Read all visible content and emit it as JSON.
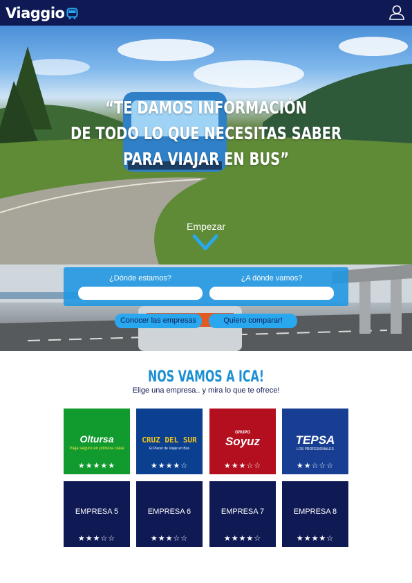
{
  "header": {
    "logo": "Viaggio",
    "icons": [
      "bus-icon",
      "user-icon"
    ]
  },
  "hero": {
    "quote_lines": [
      "“Te damos información",
      "de todo lo que necesitas saber",
      "para viajar en bus”"
    ],
    "start_label": "Empezar",
    "icons": [
      "chevron-down-icon"
    ]
  },
  "search": {
    "origin_label": "¿Dónde estamos?",
    "destination_label": "¿A dónde vamos?",
    "origin_value": "",
    "destination_value": "",
    "companies_button": "Conocer las empresas",
    "compare_button": "Quiero comparar!"
  },
  "section": {
    "title": "Nos vamos a ICA!",
    "subtitle": "Elige una empresa.. y mira lo que te ofrece!"
  },
  "companies": [
    {
      "name": "Oltursa",
      "tagline": "Viaja seguro en primera clase",
      "rating": 5,
      "stars": "★★★★★",
      "bg": "#119a2e"
    },
    {
      "name": "CRUZ DEL SUR",
      "tagline": "El Placer de Viajar en Bus",
      "rating": 4,
      "stars": "★★★★☆",
      "bg": "#0b3f8f"
    },
    {
      "name": "Soyuz",
      "tagline": "GRUPO",
      "rating": 3,
      "stars": "★★★☆☆",
      "bg": "#b30f1f"
    },
    {
      "name": "TEPSA",
      "tagline": "LOS PROFESIONALES",
      "rating": 2,
      "stars": "★★☆☆☆",
      "bg": "#183e93"
    },
    {
      "name": "EMPRESA 5",
      "rating": 3,
      "stars": "★★★☆☆",
      "bg": "#0f1a54"
    },
    {
      "name": "EMPRESA 6",
      "rating": 3,
      "stars": "★★★☆☆",
      "bg": "#0f1a54"
    },
    {
      "name": "EMPRESA 7",
      "rating": 4,
      "stars": "★★★★☆",
      "bg": "#0f1a54"
    },
    {
      "name": "EMPRESA 8",
      "rating": 4,
      "stars": "★★★★☆",
      "bg": "#0f1a54"
    }
  ],
  "colors": {
    "navy": "#0f1a54",
    "accent_blue": "#1b8fd3",
    "button_blue": "#29a8ef"
  }
}
